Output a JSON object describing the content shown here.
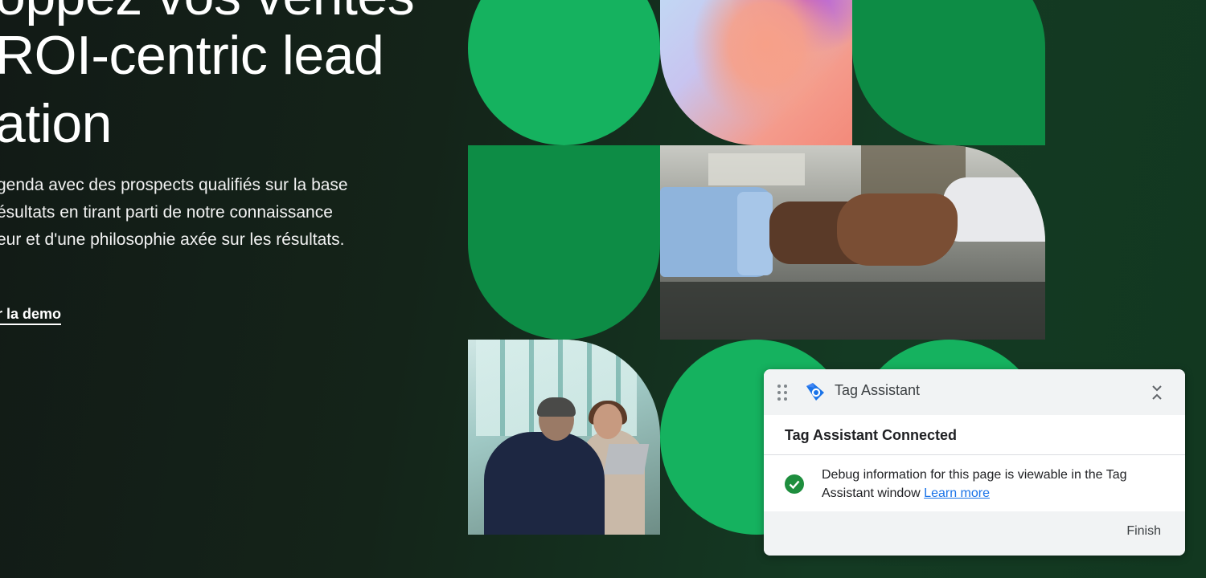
{
  "hero": {
    "headline_line1": "oppez vos ventes",
    "headline_line2": "ROI-centric lead",
    "headline_line3": "ation",
    "description_lines": [
      "genda avec des prospects qualifiés sur la base",
      "ésultats en tirant parti de notre connaissance",
      "eur et d'une philosophie axée sur les résultats."
    ],
    "cta_label": "r la demo"
  },
  "colors": {
    "page_bg": "#142419",
    "green_bright": "#15b25f",
    "green_dark": "#0d8c45",
    "panel_bg": "#ffffff",
    "link_blue": "#1a73e8",
    "check_green": "#1e8e3e"
  },
  "tag_assistant": {
    "title": "Tag Assistant",
    "status": "Tag Assistant Connected",
    "message": "Debug information for this page is viewable in the Tag Assistant window",
    "link_label": "Learn more",
    "finish_label": "Finish",
    "icons": {
      "drag": "drag-handle-icon",
      "logo": "tag-assistant-logo-icon",
      "collapse": "collapse-icon",
      "status": "check-circle-icon"
    }
  }
}
